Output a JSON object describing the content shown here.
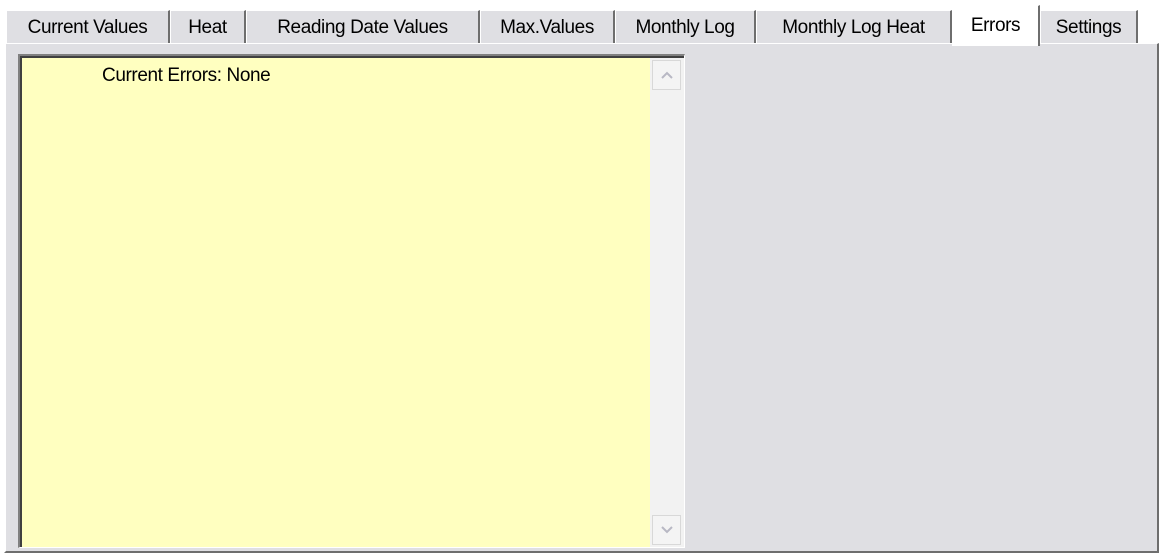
{
  "tabs": [
    {
      "label": "Current Values",
      "active": false
    },
    {
      "label": "Heat",
      "active": false
    },
    {
      "label": "Reading Date Values",
      "active": false
    },
    {
      "label": "Max.Values",
      "active": false
    },
    {
      "label": "Monthly Log",
      "active": false
    },
    {
      "label": "Monthly Log  Heat",
      "active": false
    },
    {
      "label": "Errors",
      "active": true
    },
    {
      "label": "Settings",
      "active": false
    }
  ],
  "errors_panel": {
    "list": {
      "status_text": "Current Errors: None"
    },
    "scrollbar": {
      "up_icon": "chevron-up-icon",
      "down_icon": "chevron-down-icon"
    }
  },
  "colors": {
    "panel_background": "#dfdfe3",
    "list_background": "#ffffc0",
    "active_tab_background": "#ffffff"
  }
}
